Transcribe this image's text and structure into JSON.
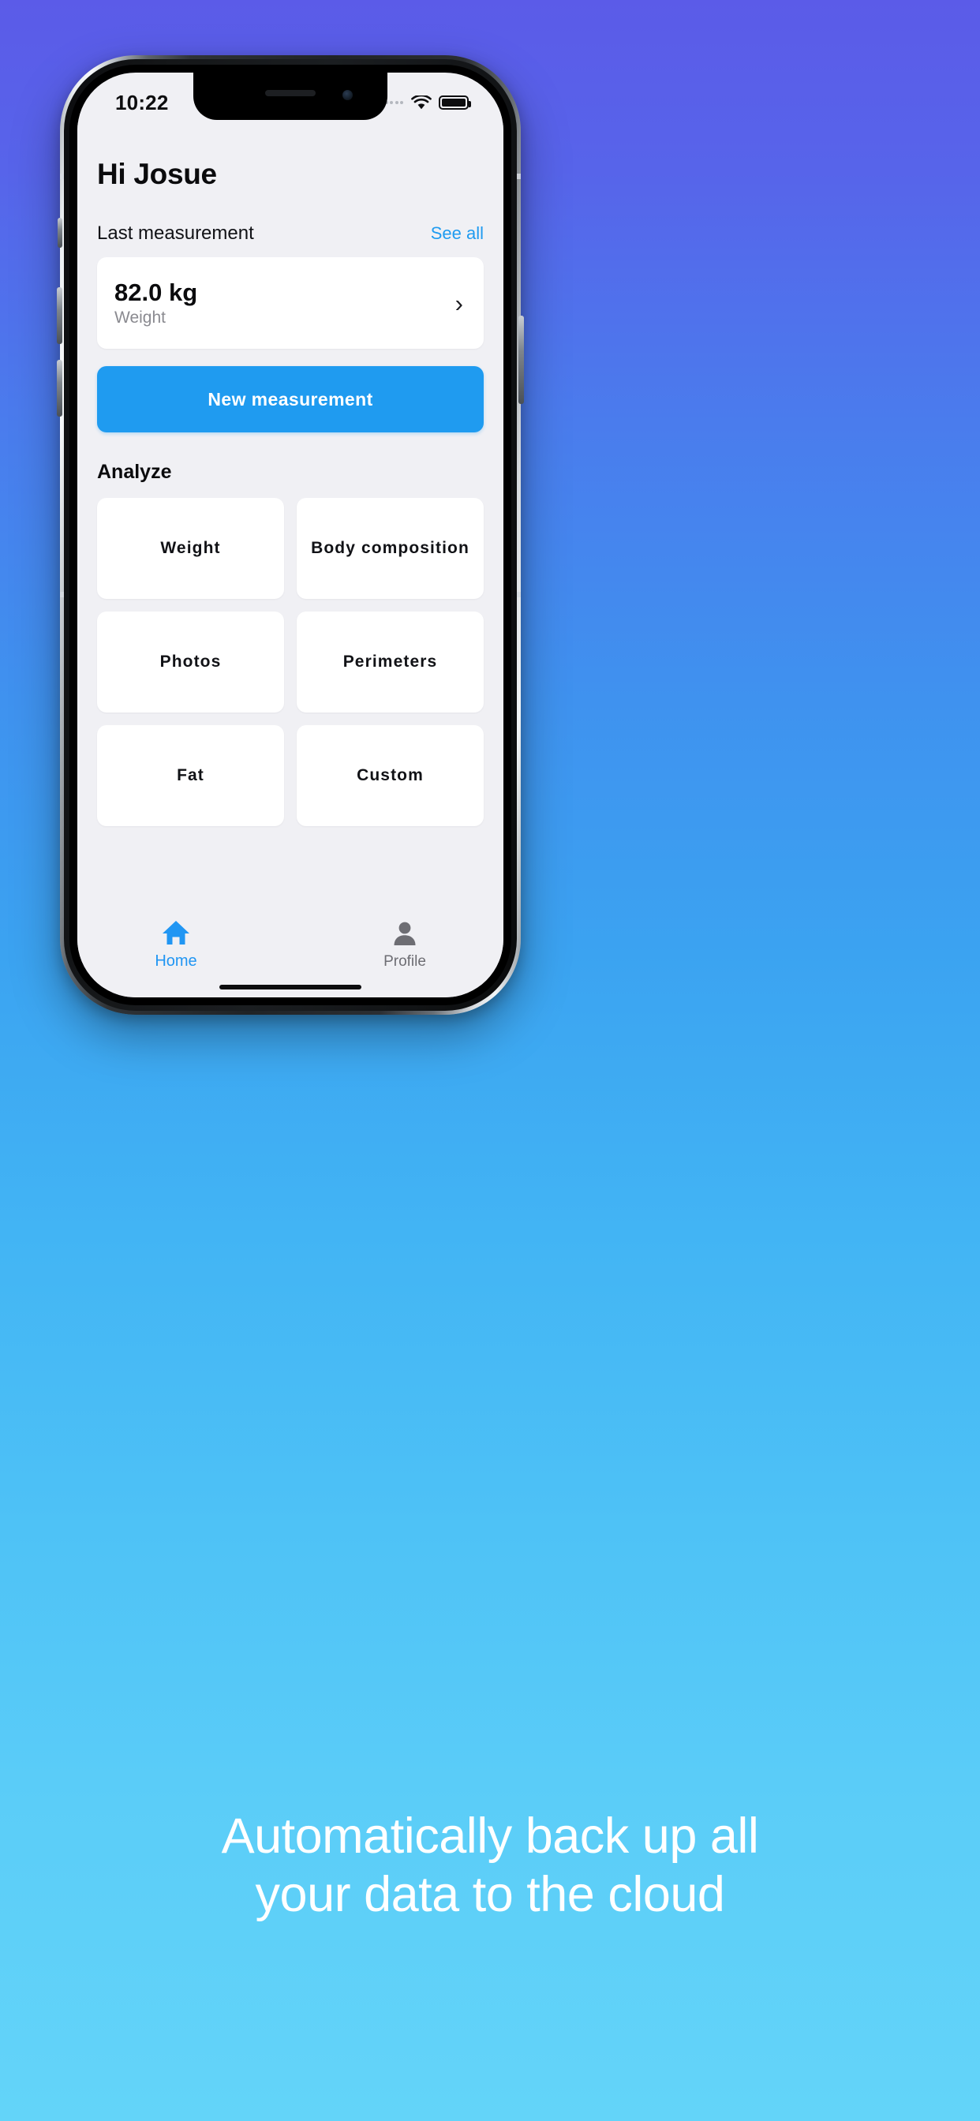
{
  "status_bar": {
    "time": "10:22",
    "wifi_icon": "wifi-icon",
    "battery_icon": "battery-full-icon",
    "signal_icon": "signal-dots-icon"
  },
  "app": {
    "greeting": "Hi Josue",
    "last_measurement": {
      "section_title": "Last measurement",
      "see_all_label": "See all",
      "value": "82.0 kg",
      "label": "Weight",
      "chevron_icon": "chevron-right-icon"
    },
    "cta_label": "New measurement",
    "analyze": {
      "title": "Analyze",
      "tiles": [
        {
          "label": "Weight"
        },
        {
          "label": "Body composition"
        },
        {
          "label": "Photos"
        },
        {
          "label": "Perimeters"
        },
        {
          "label": "Fat"
        },
        {
          "label": "Custom"
        }
      ]
    },
    "tabs": [
      {
        "label": "Home",
        "icon": "home-icon",
        "active": true
      },
      {
        "label": "Profile",
        "icon": "person-icon",
        "active": false
      }
    ]
  },
  "caption": {
    "line1": "Automatically back up all",
    "line2": "your data to the cloud"
  },
  "colors": {
    "accent_blue": "#1f9bf0",
    "tab_active": "#2196f3",
    "tab_inactive": "#6d6d73",
    "screen_bg": "#f0f0f4",
    "card_bg": "#ffffff",
    "text_primary": "#0b0b0d",
    "text_secondary": "#8a8a90",
    "bg_gradient_top": "#5b5be8",
    "bg_gradient_bottom": "#63d4f9"
  }
}
